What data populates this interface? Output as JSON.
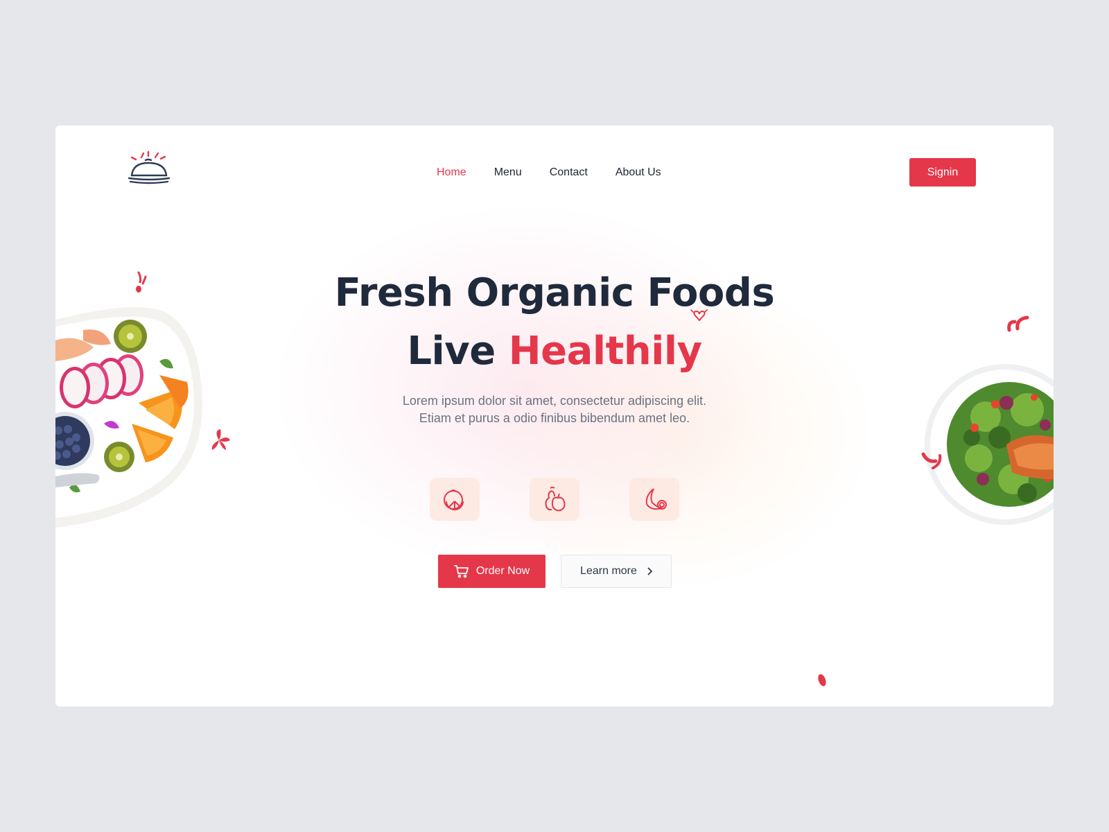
{
  "nav": {
    "items": [
      {
        "label": "Home",
        "active": true
      },
      {
        "label": "Menu",
        "active": false
      },
      {
        "label": "Contact",
        "active": false
      },
      {
        "label": "About Us",
        "active": false
      }
    ],
    "signin_label": "Signin"
  },
  "logo": {
    "icon": "cloche-icon"
  },
  "hero": {
    "line1": "Fresh Organic Foods",
    "line2_plain": "Live ",
    "line2_accent": "Healthily",
    "subtitle_line1": "Lorem ipsum dolor sit amet, consectetur adipiscing elit.",
    "subtitle_line2": "Etiam et purus a odio finibus bibendum amet leo."
  },
  "features": [
    {
      "icon": "citrus-icon"
    },
    {
      "icon": "pear-apple-icon"
    },
    {
      "icon": "banana-icon"
    }
  ],
  "actions": {
    "order_label": "Order Now",
    "order_icon": "cart-icon",
    "learn_label": "Learn more",
    "learn_icon": "chevron-right-icon"
  },
  "colors": {
    "accent": "#e5374a",
    "heading": "#1f2a3c",
    "page_bg": "#e6e7eb",
    "icon_tile": "#fdeae3"
  }
}
